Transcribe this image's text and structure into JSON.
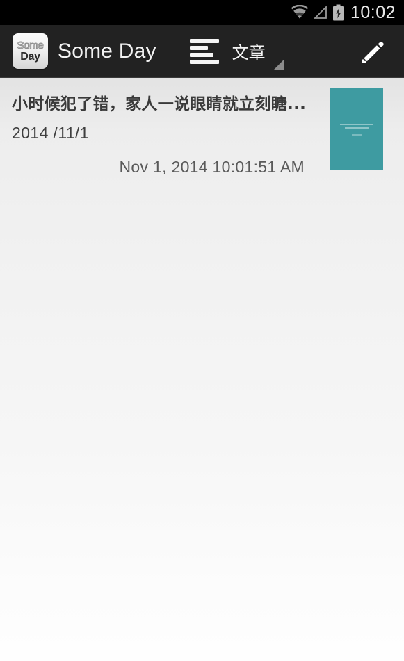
{
  "status_bar": {
    "time": "10:02",
    "icons": [
      "wifi-icon",
      "cellular-signal-icon",
      "battery-charging-icon"
    ]
  },
  "action_bar": {
    "logo": {
      "line1": "Some",
      "line2": "Day",
      "name": "app-logo-icon"
    },
    "title": "Some Day",
    "spinner": {
      "label": "文章",
      "icon": "article-list-icon",
      "caret": "dropdown-caret-icon"
    },
    "edit_button": {
      "icon": "pencil-edit-icon",
      "label": ""
    }
  },
  "notes": [
    {
      "title": "小时候犯了错，家人一说眼睛就立刻瞊...",
      "date": "2014 /11/1",
      "timestamp": "Nov 1, 2014 10:01:51 AM",
      "thumbnail_color": "#3e9ba1"
    }
  ],
  "colors": {
    "status_bar_bg": "#000000",
    "action_bar_bg": "#222222",
    "content_bg": "#f1f1f1",
    "thumbnail_teal": "#3e9ba1",
    "title_text": "#3a3a3a"
  }
}
